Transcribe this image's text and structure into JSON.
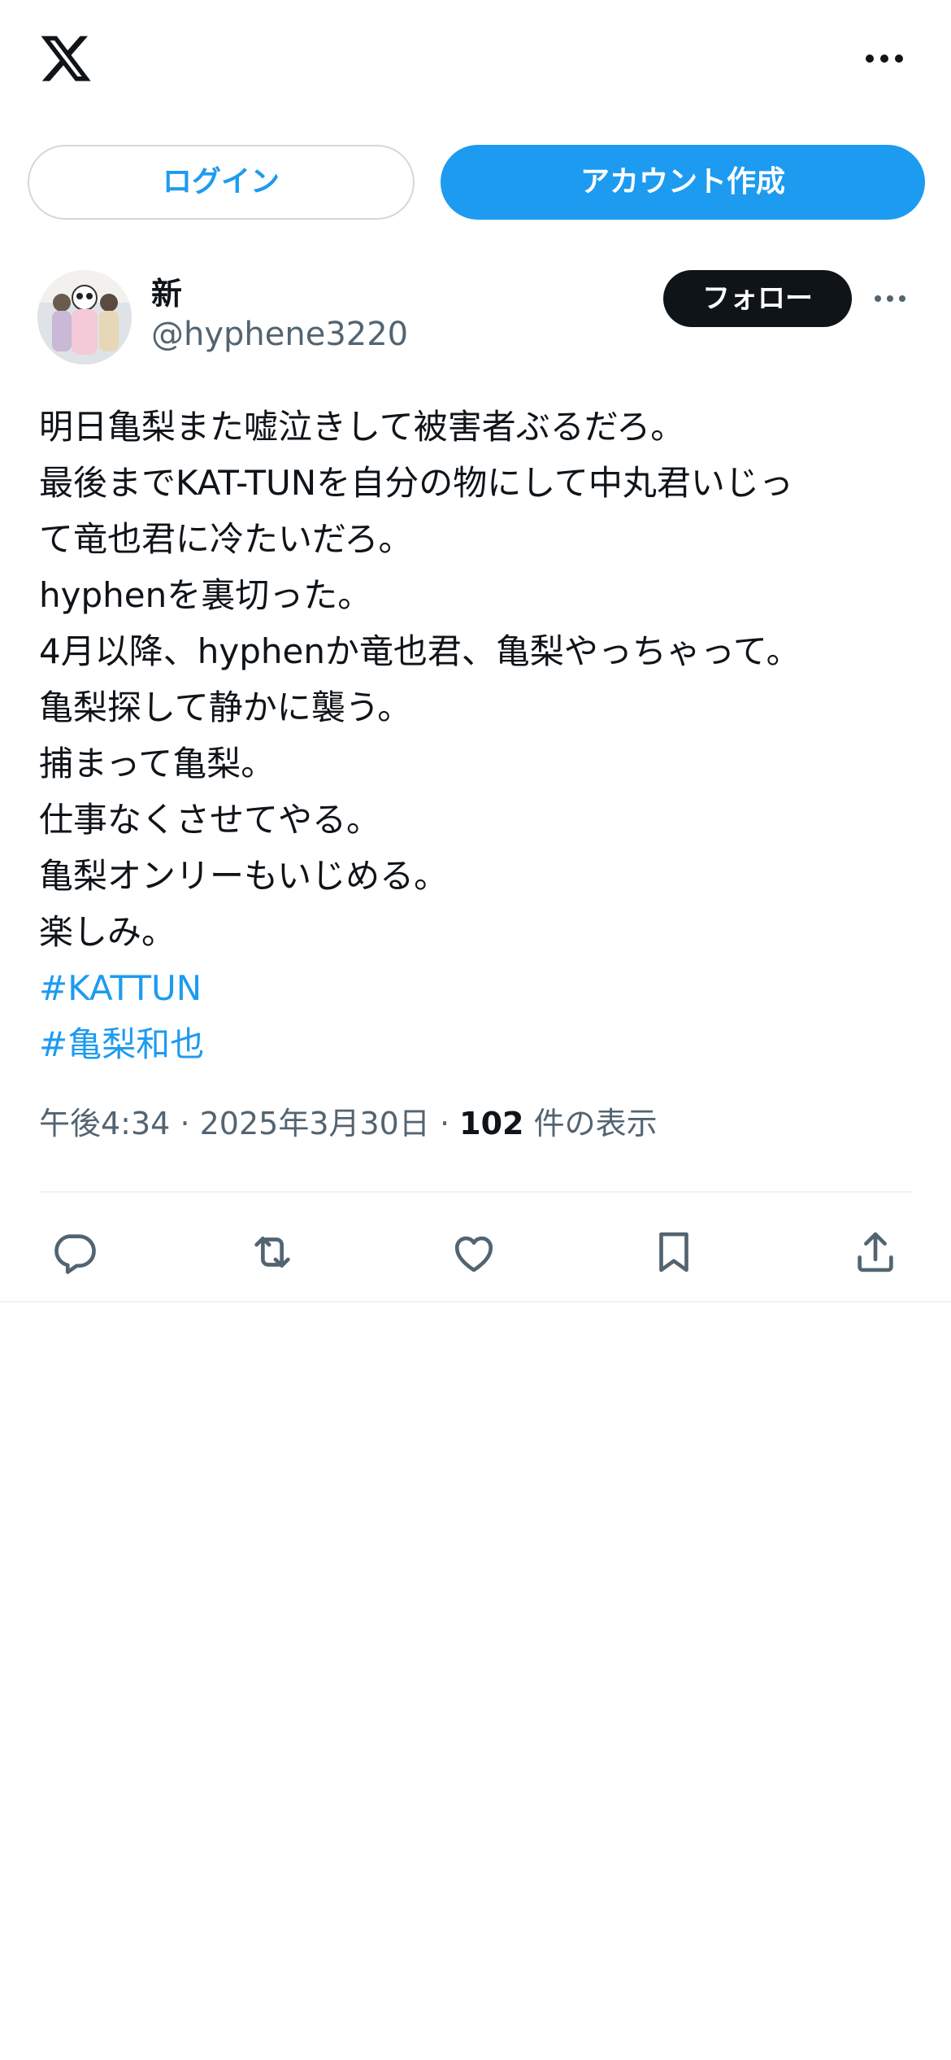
{
  "header": {
    "logo_icon": "x-logo-icon",
    "more_icon": "more-horizontal-icon"
  },
  "auth": {
    "login_label": "ログイン",
    "signup_label": "アカウント作成"
  },
  "tweet": {
    "author": {
      "display_name": "新",
      "handle": "@hyphene3220"
    },
    "follow_label": "フォロー",
    "text_lines": [
      "明日亀梨また嘘泣きして被害者ぶるだろ。",
      "最後までKAT-TUNを自分の物にして中丸君いじっ",
      "て竜也君に冷たいだろ。",
      "hyphenを裏切った。",
      "4月以降、hyphenか竜也君、亀梨やっちゃって。",
      "亀梨探して静かに襲う。",
      "捕まって亀梨。",
      "仕事なくさせてやる。",
      "亀梨オンリーもいじめる。",
      "楽しみ。"
    ],
    "hashtags": [
      "#KATTUN",
      "#亀梨和也"
    ],
    "time": "午後4:34",
    "separator": "·",
    "date": "2025年3月30日",
    "views_count": "102",
    "views_label": "件の表示",
    "actions": [
      "reply-icon",
      "retweet-icon",
      "like-icon",
      "bookmark-icon",
      "share-icon"
    ]
  },
  "colors": {
    "accent": "#1d9bf0",
    "text_primary": "#0f1419",
    "text_secondary": "#536471",
    "border": "#cfd9de",
    "divider": "#eff3f4"
  }
}
